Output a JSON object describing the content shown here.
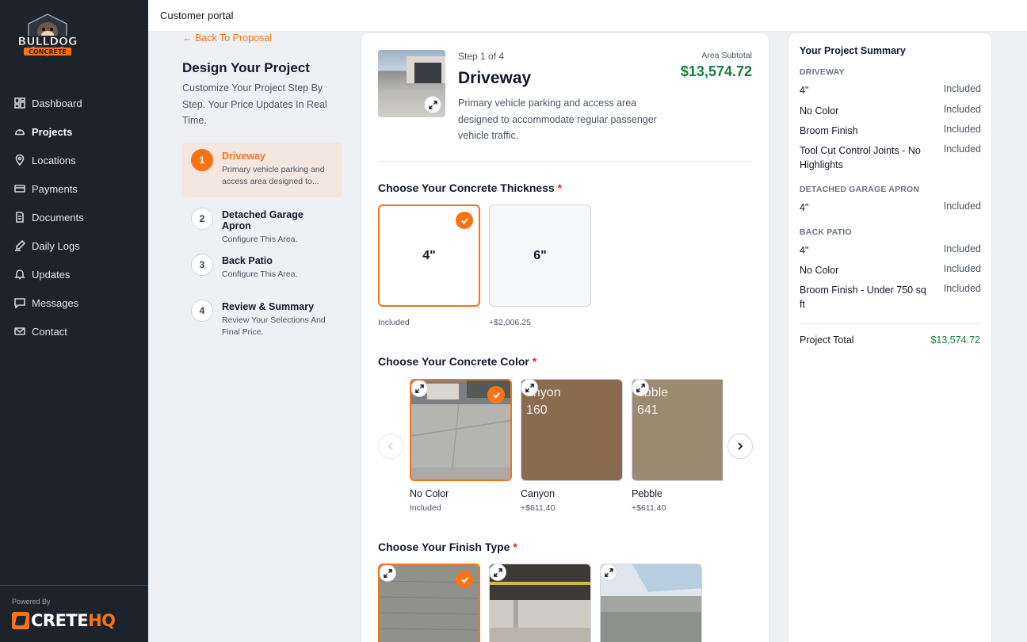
{
  "topbar": {
    "title": "Customer portal"
  },
  "sidebar": {
    "logo_top": "BULLDOG",
    "logo_bottom": "CONCRETE",
    "items": [
      {
        "label": "Dashboard",
        "icon": "dashboard-icon"
      },
      {
        "label": "Projects",
        "icon": "hard-hat-icon",
        "active": true
      },
      {
        "label": "Locations",
        "icon": "map-pin-icon"
      },
      {
        "label": "Payments",
        "icon": "credit-card-icon"
      },
      {
        "label": "Documents",
        "icon": "document-icon"
      },
      {
        "label": "Daily Logs",
        "icon": "edit-log-icon"
      },
      {
        "label": "Updates",
        "icon": "bell-icon"
      },
      {
        "label": "Messages",
        "icon": "message-icon"
      },
      {
        "label": "Contact",
        "icon": "mail-icon"
      }
    ],
    "powered_by": "Powered By",
    "brand_crete": "CRETE",
    "brand_hq": "HQ"
  },
  "left": {
    "back_link": "← Back To Proposal",
    "title": "Design Your Project",
    "subtitle": "Customize Your Project Step By Step. Your Price Updates In Real Time.",
    "steps": [
      {
        "num": "1",
        "title": "Driveway",
        "desc": "Primary vehicle parking and access area designed to...",
        "active": true
      },
      {
        "num": "2",
        "title": "Detached Garage Apron",
        "desc": "Configure This Area."
      },
      {
        "num": "3",
        "title": "Back Patio",
        "desc": "Configure This Area."
      },
      {
        "num": "4",
        "title": "Review & Summary",
        "desc": "Review Your Selections And Final Price."
      }
    ]
  },
  "main": {
    "step_of": "Step 1 of 4",
    "area_title": "Driveway",
    "area_desc": "Primary vehicle parking and access area designed to accommodate regular passenger vehicle traffic.",
    "subtotal_label": "Area Subtotal",
    "subtotal_value": "$13,574.72",
    "thickness": {
      "title": "Choose Your Concrete Thickness",
      "required": "*",
      "options": [
        {
          "label": "4\"",
          "price": "Included",
          "selected": true
        },
        {
          "label": "6\"",
          "price": "+$2,006.25"
        }
      ]
    },
    "color": {
      "title": "Choose Your Concrete Color",
      "required": "*",
      "options": [
        {
          "name": "No Color",
          "price": "Included",
          "selected": true,
          "swatch_text": ""
        },
        {
          "name": "Canyon",
          "price": "+$611.40",
          "swatch_text": "anyon\n160",
          "color": "#8b6b50"
        },
        {
          "name": "Pebble",
          "price": "+$611.40",
          "swatch_text": "ebble\n641",
          "color": "#9a8a72"
        }
      ]
    },
    "finish": {
      "title": "Choose Your Finish Type",
      "required": "*"
    }
  },
  "summary": {
    "title": "Your Project Summary",
    "groups": [
      {
        "name": "DRIVEWAY",
        "rows": [
          {
            "label": "4\"",
            "value": "Included"
          },
          {
            "label": "No Color",
            "value": "Included"
          },
          {
            "label": "Broom Finish",
            "value": "Included"
          },
          {
            "label": "Tool Cut Control Joints - No Highlights",
            "value": "Included"
          }
        ]
      },
      {
        "name": "DETACHED GARAGE APRON",
        "rows": [
          {
            "label": "4\"",
            "value": "Included"
          }
        ]
      },
      {
        "name": "BACK PATIO",
        "rows": [
          {
            "label": "4\"",
            "value": "Included"
          },
          {
            "label": "No Color",
            "value": "Included"
          },
          {
            "label": "Broom Finish - Under 750 sq ft",
            "value": "Included"
          }
        ]
      }
    ],
    "total_label": "Project Total",
    "total_value": "$13,574.72"
  },
  "colors": {
    "accent": "#f97316",
    "sidebar": "#1d232b",
    "money": "#15803d"
  }
}
